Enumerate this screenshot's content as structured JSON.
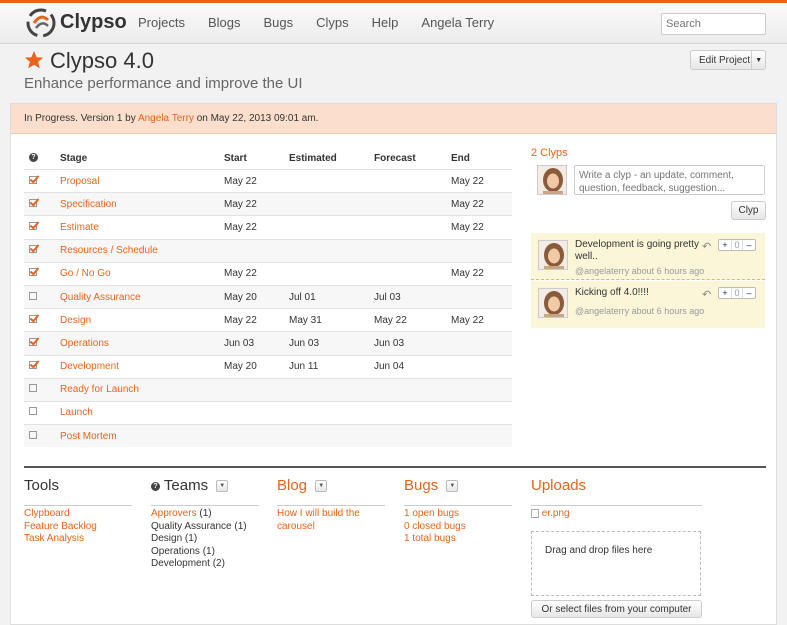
{
  "brand": "Clypso",
  "nav": [
    "Projects",
    "Blogs",
    "Bugs",
    "Clyps",
    "Help",
    "Angela Terry"
  ],
  "search_placeholder": "Search",
  "project": {
    "title": "Clypso 4.0",
    "subtitle": "Enhance performance and improve the UI",
    "edit_button": "Edit Project"
  },
  "status": {
    "prefix": "In Progress. Version 1 by ",
    "user": "Angela Terry",
    "suffix": " on May 22, 2013 09:01 am."
  },
  "stages": {
    "headers": {
      "stage": "Stage",
      "start": "Start",
      "estimated": "Estimated",
      "forecast": "Forecast",
      "end": "End"
    },
    "rows": [
      {
        "checked": true,
        "stage": "Proposal",
        "start": "May 22",
        "estimated": "",
        "forecast": "",
        "end": "May 22"
      },
      {
        "checked": true,
        "stage": "Specification",
        "start": "May 22",
        "estimated": "",
        "forecast": "",
        "end": "May 22"
      },
      {
        "checked": true,
        "stage": "Estimate",
        "start": "May 22",
        "estimated": "",
        "forecast": "",
        "end": "May 22"
      },
      {
        "checked": true,
        "stage": "Resources / Schedule",
        "start": "",
        "estimated": "",
        "forecast": "",
        "end": ""
      },
      {
        "checked": true,
        "stage": "Go / No Go",
        "start": "May 22",
        "estimated": "",
        "forecast": "",
        "end": "May 22"
      },
      {
        "checked": false,
        "stage": "Quality Assurance",
        "start": "May 20",
        "estimated": "Jul 01",
        "forecast": "Jul 03",
        "end": ""
      },
      {
        "checked": true,
        "stage": "Design",
        "start": "May 22",
        "estimated": "May 31",
        "forecast": "May 22",
        "end": "May 22"
      },
      {
        "checked": true,
        "stage": "Operations",
        "start": "Jun 03",
        "estimated": "Jun 03",
        "forecast": "Jun 03",
        "end": ""
      },
      {
        "checked": true,
        "stage": "Development",
        "start": "May 20",
        "estimated": "Jun 11",
        "forecast": "Jun 04",
        "end": ""
      },
      {
        "checked": false,
        "stage": "Ready for Launch",
        "start": "",
        "estimated": "",
        "forecast": "",
        "end": ""
      },
      {
        "checked": false,
        "stage": "Launch",
        "start": "",
        "estimated": "",
        "forecast": "",
        "end": ""
      },
      {
        "checked": false,
        "stage": "Post Mortem",
        "start": "",
        "estimated": "",
        "forecast": "",
        "end": ""
      }
    ]
  },
  "clyps": {
    "title": "2 Clyps",
    "placeholder": "Write a clyp - an update, comment, question, feedback, suggestion...",
    "button": "Clyp",
    "items": [
      {
        "text": "Development is going pretty well..",
        "meta": "@angelaterry about 6 hours ago",
        "votes": "0"
      },
      {
        "text": "Kicking off 4.0!!!!",
        "meta": "@angelaterry about 6 hours ago",
        "votes": "0"
      }
    ]
  },
  "tools": {
    "title": "Tools",
    "items": [
      "Clypboard",
      "Feature Backlog",
      "Task Analysis"
    ]
  },
  "teams": {
    "title": "Teams",
    "items": [
      {
        "name": "Approvers",
        "count": "(1)"
      },
      {
        "name": "Quality Assurance",
        "count": "(1)"
      },
      {
        "name": "Design",
        "count": "(1)"
      },
      {
        "name": "Operations",
        "count": "(1)"
      },
      {
        "name": "Development",
        "count": "(2)"
      }
    ]
  },
  "blog": {
    "title": "Blog",
    "items": [
      "How I will build the carousel"
    ]
  },
  "bugs": {
    "title": "Bugs",
    "items": [
      "1 open bugs",
      "0 closed bugs",
      "1 total bugs"
    ]
  },
  "uploads": {
    "title": "Uploads",
    "file": "er.png",
    "dropzone": "Drag and drop files here",
    "button": "Or select files from your computer"
  },
  "colors": {
    "accent": "#e8641b",
    "status_bg": "#fbdfcc",
    "clyp_bg": "#fcf6d9"
  }
}
